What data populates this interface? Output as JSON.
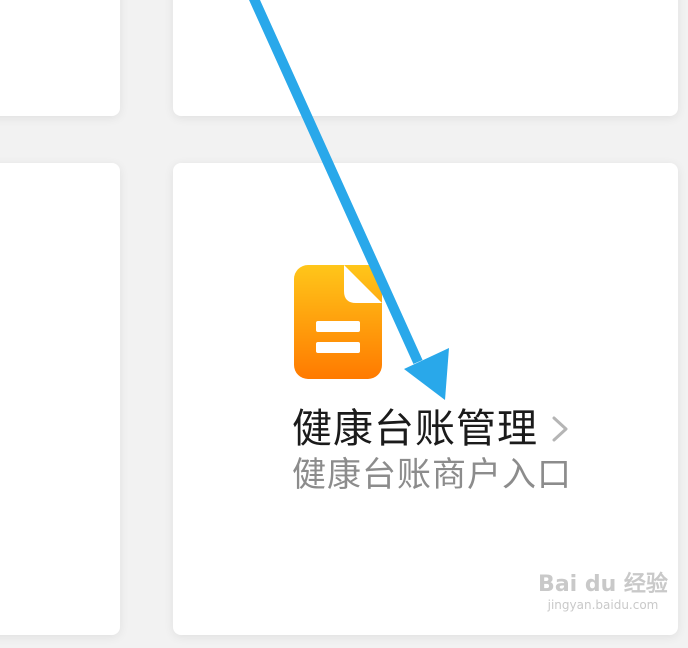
{
  "card": {
    "title": "健康台账管理",
    "subtitle": "健康台账商户入口"
  },
  "icons": {
    "document": "document-icon",
    "chevron": "chevron-right-icon",
    "arrow": "annotation-arrow"
  },
  "watermark": {
    "main": "Bai du 经验",
    "sub": "jingyan.baidu.com"
  },
  "colors": {
    "arrow": "#29a8ea",
    "icon_top": "#ffc61a",
    "icon_bottom": "#ff7a00"
  }
}
